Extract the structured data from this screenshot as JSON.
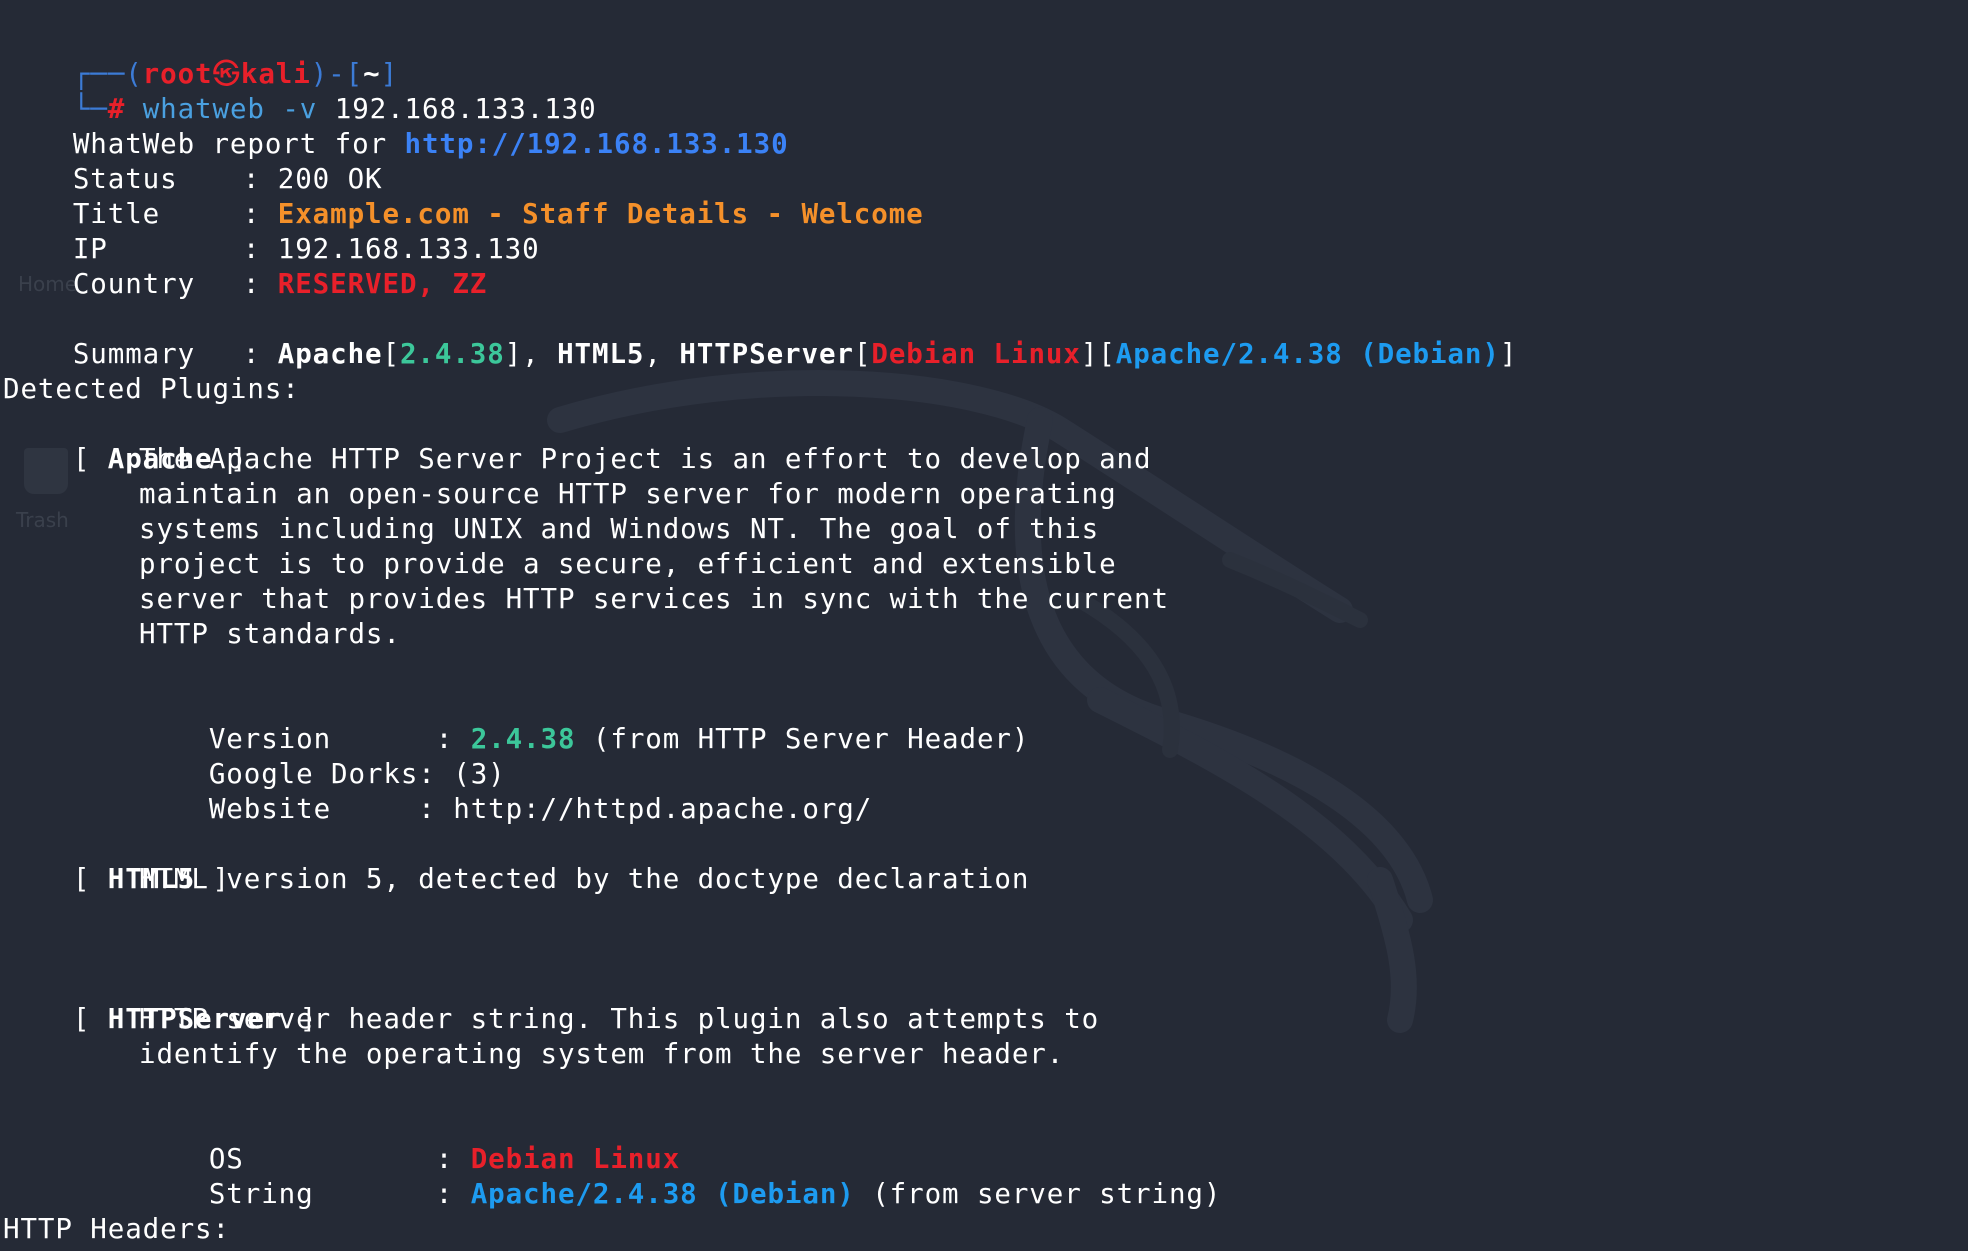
{
  "prompt": {
    "user": "root",
    "at_symbol": "㉿",
    "host": "kali",
    "cwd": "~",
    "symbol": "#",
    "command": "whatweb -v",
    "target": "192.168.133.130"
  },
  "report": {
    "header": "WhatWeb report for",
    "url": "http://192.168.133.130",
    "status_label": "Status",
    "status_value": "200 OK",
    "title_label": "Title",
    "title_value": "Example.com - Staff Details - Welcome",
    "ip_label": "IP",
    "ip_value": "192.168.133.130",
    "country_label": "Country",
    "country_value": "RESERVED, ZZ",
    "summary_label": "Summary",
    "summary": {
      "apache": "Apache",
      "apache_version": "2.4.38",
      "html5": "HTML5",
      "httpserver": "HTTPServer",
      "os": "Debian Linux",
      "server_string": "Apache/2.4.38 (Debian)"
    }
  },
  "plugins": {
    "heading": "Detected Plugins:",
    "apache": {
      "name": "Apache",
      "description": [
        "The Apache HTTP Server Project is an effort to develop and",
        "maintain an open-source HTTP server for modern operating",
        "systems including UNIX and Windows NT. The goal of this",
        "project is to provide a secure, efficient and extensible",
        "server that provides HTTP services in sync with the current",
        "HTTP standards."
      ],
      "version_label": "Version      :",
      "version_value": "2.4.38",
      "version_source": "(from HTTP Server Header)",
      "dorks_label": "Google Dorks:",
      "dorks_value": "(3)",
      "website_label": "Website     :",
      "website_value": "http://httpd.apache.org/"
    },
    "html5": {
      "name": "HTML5",
      "description": "HTML version 5, detected by the doctype declaration"
    },
    "httpserver": {
      "name": "HTTPServer",
      "description": [
        "HTTP server header string. This plugin also attempts to",
        "identify the operating system from the server header."
      ],
      "os_label": "OS           :",
      "os_value": "Debian Linux",
      "string_label": "String       :",
      "string_value": "Apache/2.4.38 (Debian)",
      "string_source": "(from server string)"
    }
  },
  "footer": {
    "headers_label": "HTTP Headers:"
  },
  "desktop": {
    "home_label": "Home",
    "trash_label": "Trash"
  },
  "colors": {
    "background": "#252a36",
    "prompt_frame": "#3c7bd6",
    "prompt_user": "#e8202a",
    "url": "#3b82f6",
    "title": "#f4902a",
    "version": "#3cc79a",
    "server_string": "#1d9bf0"
  }
}
